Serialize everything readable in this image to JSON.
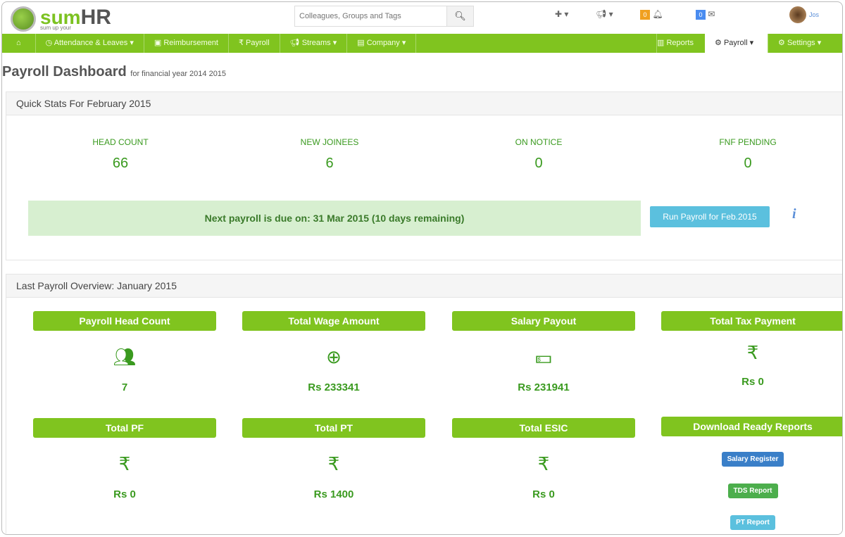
{
  "header": {
    "brand_sum": "sum",
    "brand_hr": "HR",
    "tagline": "sum up your",
    "search_placeholder": "Colleagues, Groups and Tags",
    "notif_count": "0",
    "mail_count": "0",
    "user": "Jos"
  },
  "nav": {
    "items": [
      "Attendance & Leaves ▾",
      "Reimbursement",
      "₹ Payroll",
      "Streams ▾",
      "Company ▾"
    ],
    "right": [
      "Reports",
      "Payroll ▾",
      "Settings ▾"
    ]
  },
  "page": {
    "title": "Payroll Dashboard",
    "subtitle": "for financial year 2014 2015"
  },
  "quick": {
    "heading": "Quick Stats For  February 2015",
    "stats": [
      {
        "label": "HEAD COUNT",
        "value": "66"
      },
      {
        "label": "NEW JOINEES",
        "value": "6"
      },
      {
        "label": "ON NOTICE",
        "value": "0"
      },
      {
        "label": "FNF PENDING",
        "value": "0"
      }
    ],
    "banner": "Next payroll is due on: 31 Mar 2015 (10 days remaining)",
    "run_button": "Run Payroll for Feb.2015",
    "info": "i"
  },
  "overview": {
    "heading": "Last Payroll Overview: January 2015",
    "cards": [
      {
        "title": "Payroll Head Count",
        "icon": "users-icon",
        "value": "7"
      },
      {
        "title": "Total Wage Amount",
        "icon": "plus-circle-icon",
        "value": "Rs 233341"
      },
      {
        "title": "Salary Payout",
        "icon": "money-icon",
        "value": "Rs 231941"
      },
      {
        "title": "Total Tax Payment",
        "icon": "rupee-icon",
        "value": "Rs 0"
      },
      {
        "title": "Total PF",
        "icon": "rupee-icon",
        "value": "Rs 0"
      },
      {
        "title": "Total PT",
        "icon": "rupee-icon",
        "value": "Rs 1400"
      },
      {
        "title": "Total ESIC",
        "icon": "rupee-icon",
        "value": "Rs 0"
      }
    ],
    "reports_title": "Download Ready Reports",
    "reports": [
      "Salary Register",
      "TDS Report",
      "PT Report"
    ],
    "colors": {
      "salary": "#3a7fc8",
      "tds": "#4cae4c",
      "pt": "#5bc0de"
    }
  }
}
